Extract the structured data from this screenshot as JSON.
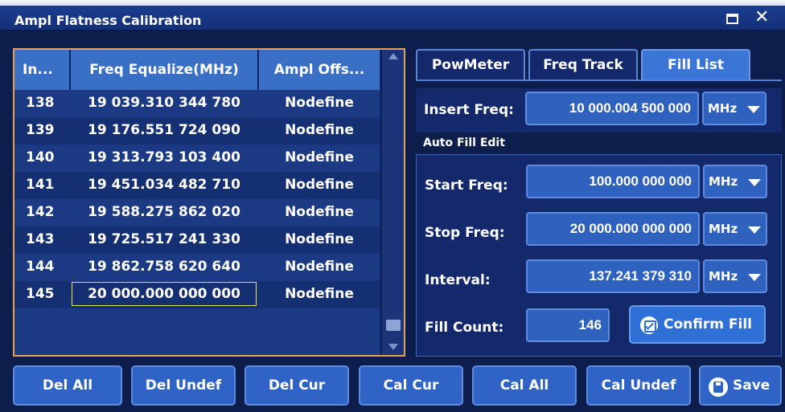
{
  "window": {
    "title": "Ampl Flatness Calibration"
  },
  "table": {
    "headers": [
      "In...",
      "Freq Equalize(MHz)",
      "Ampl Offs..."
    ],
    "rows": [
      [
        "138",
        "19 039.310 344 780",
        "Nodefine"
      ],
      [
        "139",
        "19 176.551 724 090",
        "Nodefine"
      ],
      [
        "140",
        "19 313.793 103 400",
        "Nodefine"
      ],
      [
        "141",
        "19 451.034 482 710",
        "Nodefine"
      ],
      [
        "142",
        "19 588.275 862 020",
        "Nodefine"
      ],
      [
        "143",
        "19 725.517 241 330",
        "Nodefine"
      ],
      [
        "144",
        "19 862.758 620 640",
        "Nodefine"
      ],
      [
        "145",
        "20 000.000 000 000",
        "Nodefine"
      ]
    ]
  },
  "tabs": [
    "PowMeter",
    "Freq Track",
    "Fill List"
  ],
  "insert": {
    "label": "Insert Freq:",
    "value": "10 000.004 500 000",
    "unit": "MHz"
  },
  "auto_fill": {
    "title": "Auto Fill Edit",
    "start": {
      "label": "Start Freq:",
      "value": "100.000 000 000",
      "unit": "MHz"
    },
    "stop": {
      "label": "Stop Freq:",
      "value": "20 000.000 000 000",
      "unit": "MHz"
    },
    "interval": {
      "label": "Interval:",
      "value": "137.241 379 310",
      "unit": "MHz"
    },
    "count": {
      "label": "Fill Count:",
      "value": "146"
    },
    "confirm": "Confirm Fill"
  },
  "buttons": {
    "del_all": "Del All",
    "del_undef": "Del Undef",
    "del_cur": "Del Cur",
    "cal_cur": "Cal Cur",
    "cal_all": "Cal All",
    "cal_undef": "Cal Undef",
    "save": "Save"
  },
  "colors": {
    "panel": "#13296b",
    "accent": "#3b76d6",
    "table_border": "#e3a05a",
    "selection": "#e7e35a"
  }
}
